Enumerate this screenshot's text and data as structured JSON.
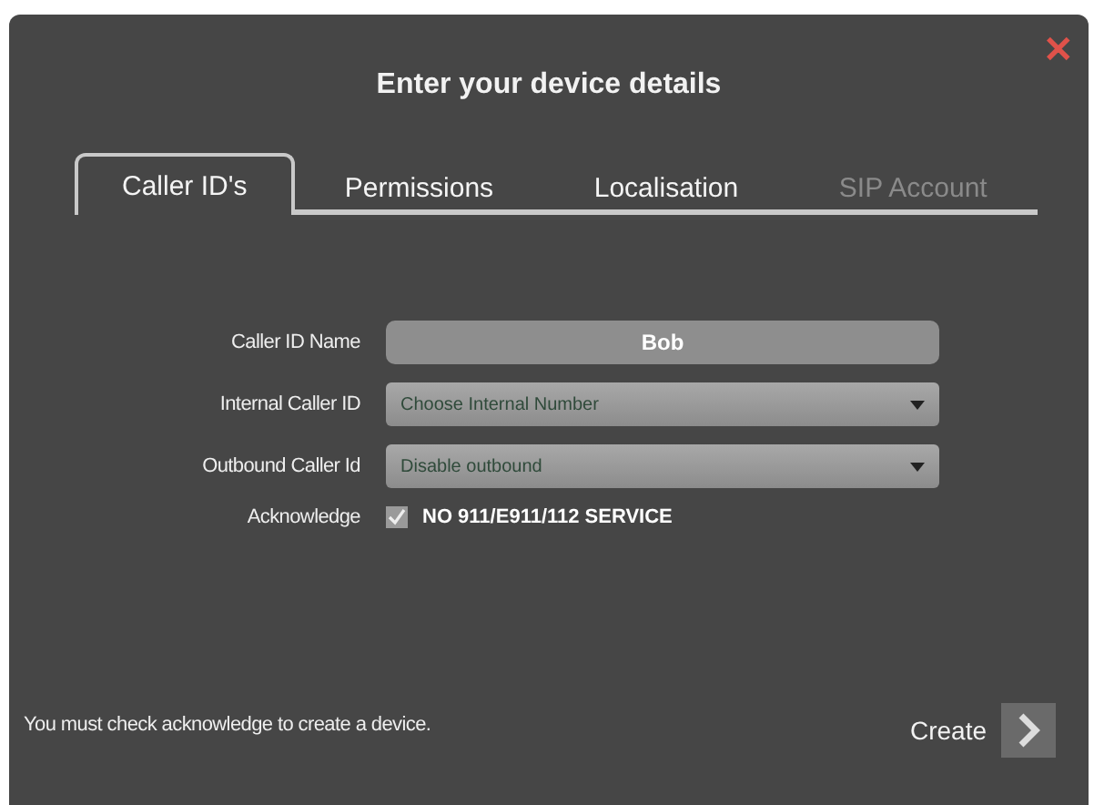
{
  "dialog": {
    "title": "Enter your device details",
    "close": "✕"
  },
  "tabs": [
    {
      "label": "Caller ID's",
      "selected": true,
      "disabled": false
    },
    {
      "label": "Permissions",
      "selected": false,
      "disabled": false
    },
    {
      "label": "Localisation",
      "selected": false,
      "disabled": false
    },
    {
      "label": "SIP Account",
      "selected": false,
      "disabled": true
    }
  ],
  "fields": [
    {
      "kind": "text",
      "label": "Caller ID Name",
      "value": "Bob"
    },
    {
      "kind": "select",
      "label": "Internal Caller ID",
      "value": "Choose Internal Number"
    },
    {
      "kind": "select",
      "label": "Outbound Caller Id",
      "value": "Disable outbound"
    },
    {
      "kind": "checkbox",
      "label": "Acknowledge",
      "value": "NO 911/E911/112 SERVICE",
      "checked": true
    }
  ],
  "footer": {
    "message": "You must check acknowledge to create a device.",
    "button": "Create"
  }
}
